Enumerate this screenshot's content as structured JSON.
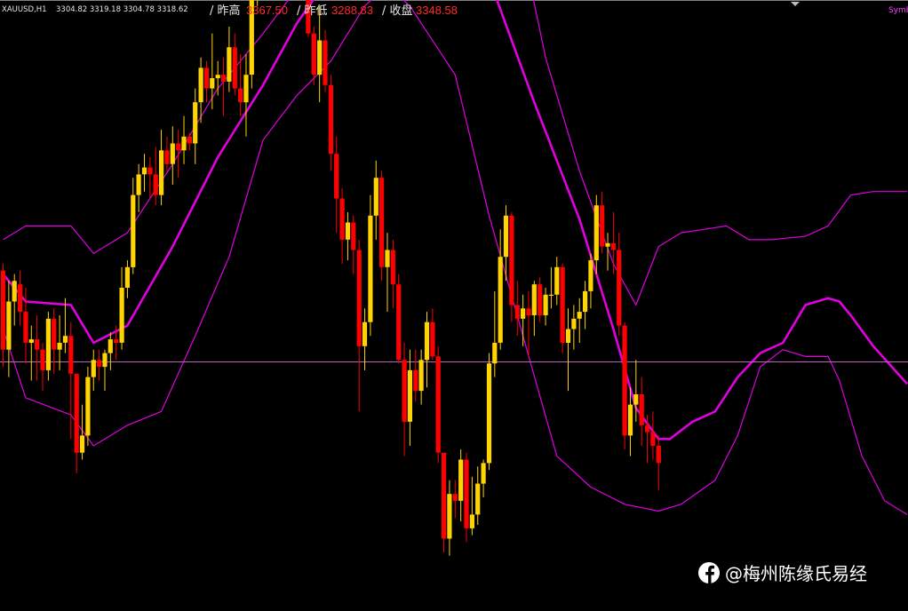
{
  "header": {
    "symbol": "XAUUSD,H1",
    "ohlc": "3304.82 3319.18 3304.78 3318.62",
    "prev_high_label": "/ 昨高",
    "prev_high_value": "3367.50",
    "prev_low_label": "/ 昨低",
    "prev_low_value": "3288.83",
    "close_label": "/ 收盘",
    "close_value": "3348.58",
    "corner_text": "Symb"
  },
  "watermark": {
    "text": "@梅州陈缘氏易经",
    "icon": "facebook-f-icon"
  },
  "colors": {
    "background": "#000000",
    "up": "#ffd400",
    "down": "#ff0000",
    "bands": "#e000e0",
    "hline": "#c060c0"
  },
  "chart_data": {
    "type": "candlestick",
    "symbol": "XAUUSD",
    "timeframe": "H1",
    "ylim": [
      3244,
      3412
    ],
    "horizontal_line": 3314.6,
    "candles": [
      [
        3341,
        3343,
        3313,
        3318
      ],
      [
        3318,
        3338,
        3310,
        3332
      ],
      [
        3332,
        3340,
        3325,
        3338
      ],
      [
        3337,
        3341,
        3325,
        3329
      ],
      [
        3329,
        3336,
        3314,
        3320
      ],
      [
        3320,
        3325,
        3309,
        3321
      ],
      [
        3321,
        3328,
        3309,
        3318
      ],
      [
        3318,
        3320,
        3306,
        3312
      ],
      [
        3312,
        3329,
        3309,
        3327
      ],
      [
        3327,
        3330,
        3311,
        3318
      ],
      [
        3318,
        3328,
        3312,
        3320
      ],
      [
        3320,
        3333,
        3317,
        3322
      ],
      [
        3322,
        3326,
        3292,
        3311
      ],
      [
        3311,
        3311,
        3282,
        3288
      ],
      [
        3288,
        3302,
        3286,
        3293
      ],
      [
        3293,
        3313,
        3290,
        3310
      ],
      [
        3310,
        3318,
        3306,
        3315
      ],
      [
        3315,
        3318,
        3309,
        3313
      ],
      [
        3313,
        3318,
        3306,
        3317
      ],
      [
        3317,
        3323,
        3312,
        3321
      ],
      [
        3321,
        3325,
        3315,
        3320
      ],
      [
        3320,
        3342,
        3318,
        3336
      ],
      [
        3336,
        3344,
        3333,
        3342
      ],
      [
        3342,
        3368,
        3340,
        3363
      ],
      [
        3363,
        3372,
        3358,
        3369
      ],
      [
        3369,
        3375,
        3364,
        3371
      ],
      [
        3371,
        3374,
        3362,
        3369
      ],
      [
        3369,
        3377,
        3360,
        3363
      ],
      [
        3363,
        3382,
        3360,
        3376
      ],
      [
        3376,
        3380,
        3370,
        3372
      ],
      [
        3372,
        3383,
        3366,
        3378
      ],
      [
        3378,
        3382,
        3368,
        3376
      ],
      [
        3376,
        3386,
        3372,
        3380
      ],
      [
        3380,
        3381,
        3376,
        3378
      ],
      [
        3378,
        3394,
        3372,
        3390
      ],
      [
        3390,
        3403,
        3384,
        3400
      ],
      [
        3400,
        3402,
        3390,
        3394
      ],
      [
        3394,
        3410,
        3388,
        3397
      ],
      [
        3397,
        3402,
        3392,
        3398
      ],
      [
        3398,
        3403,
        3386,
        3396
      ],
      [
        3396,
        3412,
        3393,
        3406
      ],
      [
        3406,
        3410,
        3392,
        3394
      ],
      [
        3394,
        3404,
        3386,
        3390
      ],
      [
        3390,
        3404,
        3380,
        3398
      ],
      [
        3398,
        3424,
        3394,
        3420
      ],
      [
        3420,
        3447,
        3418,
        3443
      ],
      [
        3443,
        3457,
        3437,
        3455
      ],
      [
        3455,
        3456,
        3444,
        3451
      ],
      [
        3451,
        3456,
        3444,
        3455
      ],
      [
        3455,
        3460,
        3442,
        3444
      ],
      [
        3444,
        3446,
        3426,
        3427
      ],
      [
        3427,
        3440,
        3424,
        3426
      ],
      [
        3426,
        3433,
        3420,
        3430
      ],
      [
        3430,
        3436,
        3426,
        3433
      ],
      [
        3433,
        3433,
        3409,
        3410
      ],
      [
        3410,
        3412,
        3395,
        3398
      ],
      [
        3398,
        3418,
        3390,
        3408
      ],
      [
        3408,
        3411,
        3393,
        3395
      ],
      [
        3395,
        3398,
        3370,
        3375
      ],
      [
        3375,
        3380,
        3352,
        3362
      ],
      [
        3362,
        3365,
        3343,
        3350
      ],
      [
        3350,
        3358,
        3344,
        3355
      ],
      [
        3355,
        3357,
        3340,
        3347
      ],
      [
        3347,
        3350,
        3300,
        3319
      ],
      [
        3319,
        3330,
        3312,
        3326
      ],
      [
        3326,
        3363,
        3322,
        3357
      ],
      [
        3357,
        3373,
        3350,
        3368
      ],
      [
        3368,
        3370,
        3338,
        3342
      ],
      [
        3342,
        3352,
        3329,
        3347
      ],
      [
        3347,
        3350,
        3330,
        3337
      ],
      [
        3337,
        3340,
        3314,
        3315
      ],
      [
        3315,
        3320,
        3287,
        3297
      ],
      [
        3297,
        3318,
        3290,
        3312
      ],
      [
        3312,
        3318,
        3303,
        3306
      ],
      [
        3306,
        3318,
        3302,
        3315
      ],
      [
        3315,
        3329,
        3307,
        3326
      ],
      [
        3326,
        3330,
        3315,
        3316
      ],
      [
        3316,
        3319,
        3285,
        3288
      ],
      [
        3288,
        3288,
        3259,
        3263
      ],
      [
        3263,
        3280,
        3258,
        3276
      ],
      [
        3276,
        3280,
        3269,
        3274
      ],
      [
        3274,
        3289,
        3268,
        3286
      ],
      [
        3286,
        3288,
        3262,
        3266
      ],
      [
        3266,
        3281,
        3264,
        3270
      ],
      [
        3270,
        3284,
        3267,
        3279
      ],
      [
        3279,
        3286,
        3275,
        3285
      ],
      [
        3285,
        3317,
        3283,
        3314
      ],
      [
        3314,
        3335,
        3310,
        3320
      ],
      [
        3320,
        3353,
        3318,
        3345
      ],
      [
        3345,
        3360,
        3338,
        3357
      ],
      [
        3357,
        3358,
        3326,
        3331
      ],
      [
        3331,
        3338,
        3322,
        3327
      ],
      [
        3327,
        3334,
        3319,
        3330
      ],
      [
        3330,
        3335,
        3316,
        3328
      ],
      [
        3328,
        3338,
        3322,
        3337
      ],
      [
        3337,
        3339,
        3326,
        3328
      ],
      [
        3328,
        3336,
        3325,
        3334
      ],
      [
        3334,
        3342,
        3330,
        3334
      ],
      [
        3334,
        3345,
        3331,
        3342
      ],
      [
        3342,
        3343,
        3317,
        3320
      ],
      [
        3320,
        3330,
        3306,
        3324
      ],
      [
        3324,
        3331,
        3318,
        3327
      ],
      [
        3327,
        3333,
        3320,
        3329
      ],
      [
        3329,
        3338,
        3324,
        3335
      ],
      [
        3335,
        3346,
        3330,
        3344
      ],
      [
        3344,
        3363,
        3340,
        3360
      ],
      [
        3360,
        3364,
        3346,
        3348
      ],
      [
        3348,
        3352,
        3341,
        3349
      ],
      [
        3349,
        3358,
        3340,
        3347
      ],
      [
        3347,
        3352,
        3322,
        3325
      ],
      [
        3325,
        3326,
        3289,
        3293
      ],
      [
        3293,
        3307,
        3287,
        3302
      ],
      [
        3302,
        3315,
        3297,
        3305
      ],
      [
        3305,
        3310,
        3290,
        3296
      ],
      [
        3296,
        3299,
        3285,
        3294
      ],
      [
        3294,
        3300,
        3286,
        3290
      ],
      [
        3290,
        3293,
        3277,
        3285
      ]
    ],
    "bollinger": {
      "mid": [
        [
          0,
          3340
        ],
        [
          4,
          3332
        ],
        [
          12,
          3331
        ],
        [
          16,
          3320
        ],
        [
          22,
          3325
        ],
        [
          30,
          3348
        ],
        [
          38,
          3374
        ],
        [
          46,
          3395
        ],
        [
          52,
          3413
        ],
        [
          58,
          3427
        ],
        [
          64,
          3440
        ],
        [
          68,
          3448
        ],
        [
          72,
          3449
        ],
        [
          76,
          3449
        ],
        [
          80,
          3444
        ],
        [
          86,
          3426
        ],
        [
          94,
          3390
        ],
        [
          102,
          3356
        ],
        [
          108,
          3324
        ],
        [
          112,
          3301
        ],
        [
          116,
          3292
        ],
        [
          118,
          3292
        ],
        [
          122,
          3297
        ],
        [
          126,
          3300
        ],
        [
          130,
          3310
        ],
        [
          134,
          3317
        ],
        [
          138,
          3320
        ],
        [
          142,
          3331
        ],
        [
          146,
          3333
        ],
        [
          148,
          3332
        ],
        [
          150,
          3328
        ],
        [
          154,
          3319
        ],
        [
          160,
          3308
        ]
      ],
      "upper": [
        [
          0,
          3350
        ],
        [
          4,
          3354
        ],
        [
          12,
          3354
        ],
        [
          16,
          3346
        ],
        [
          22,
          3352
        ],
        [
          30,
          3372
        ],
        [
          38,
          3394
        ],
        [
          46,
          3410
        ],
        [
          52,
          3423
        ],
        [
          58,
          3452
        ],
        [
          64,
          3475
        ],
        [
          68,
          3479
        ],
        [
          72,
          3479
        ],
        [
          76,
          3482
        ],
        [
          80,
          3488
        ],
        [
          84,
          3483
        ],
        [
          90,
          3450
        ],
        [
          96,
          3403
        ],
        [
          102,
          3370
        ],
        [
          108,
          3343
        ],
        [
          112,
          3331
        ],
        [
          116,
          3348
        ],
        [
          120,
          3352
        ],
        [
          124,
          3353
        ],
        [
          128,
          3354
        ],
        [
          132,
          3350
        ],
        [
          136,
          3350
        ],
        [
          142,
          3351
        ],
        [
          146,
          3354
        ],
        [
          150,
          3363
        ],
        [
          154,
          3364
        ],
        [
          160,
          3364
        ]
      ],
      "lower": [
        [
          0,
          3324
        ],
        [
          4,
          3304
        ],
        [
          12,
          3299
        ],
        [
          16,
          3290
        ],
        [
          22,
          3296
        ],
        [
          28,
          3300
        ],
        [
          34,
          3322
        ],
        [
          40,
          3345
        ],
        [
          46,
          3379
        ],
        [
          52,
          3392
        ],
        [
          58,
          3402
        ],
        [
          64,
          3418
        ],
        [
          68,
          3424
        ],
        [
          72,
          3418
        ],
        [
          80,
          3398
        ],
        [
          86,
          3357
        ],
        [
          92,
          3322
        ],
        [
          98,
          3287
        ],
        [
          104,
          3278
        ],
        [
          110,
          3273
        ],
        [
          116,
          3271
        ],
        [
          120,
          3273
        ],
        [
          126,
          3280
        ],
        [
          130,
          3293
        ],
        [
          134,
          3313
        ],
        [
          138,
          3318
        ],
        [
          142,
          3316
        ],
        [
          146,
          3316
        ],
        [
          148,
          3309
        ],
        [
          152,
          3287
        ],
        [
          156,
          3274
        ],
        [
          160,
          3270
        ]
      ]
    },
    "title": "",
    "xlabel": "",
    "ylabel": ""
  }
}
